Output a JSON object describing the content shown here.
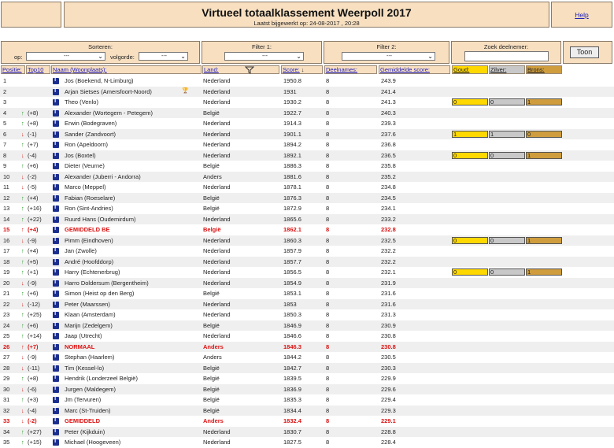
{
  "header": {
    "title": "Virtueel totaalklassement Weerpoll 2017",
    "updated": "Laatst bijgewerkt op: 24-08-2017 , 20:28",
    "help_label": "Help"
  },
  "filters": {
    "sorteren_label": "Sorteren:",
    "op_label": "op:",
    "op_value": "---",
    "volgorde_label": "volgorde:",
    "volgorde_value": "---",
    "filter1_label": "Filter 1:",
    "filter1_value": "---",
    "filter2_label": "Filter 2:",
    "filter2_value": "---",
    "zoek_label": "Zoek deelnemer:",
    "zoek_value": "",
    "toon_label": "Toon"
  },
  "columns": {
    "posities": "Positie:",
    "top10": "Top10",
    "naam": "Naam (Woonplaats):",
    "land": "Land:",
    "score": "Score:",
    "deelnames": "Deelnames:",
    "gemiddelde": "Gemiddelde score:",
    "goud": "Goud:",
    "zilver": "Zilver:",
    "brons": "Brons:"
  },
  "rows": [
    {
      "pos": "1",
      "change": "",
      "dir": "",
      "name": "Jos (Boekend, N-Limburg)",
      "land": "Nederland",
      "score": "1950.8",
      "deel": "8",
      "avg": "243.9"
    },
    {
      "pos": "2",
      "change": "",
      "dir": "",
      "name": "Arjan Sietses (Amersfoort-Noord)",
      "land": "Nederland",
      "score": "1931",
      "deel": "8",
      "avg": "241.4",
      "trophy": true
    },
    {
      "pos": "3",
      "change": "",
      "dir": "",
      "name": "Theo (Venlo)",
      "land": "Nederland",
      "score": "1930.2",
      "deel": "8",
      "avg": "241.3",
      "medals": [
        "0",
        "0",
        "1"
      ]
    },
    {
      "pos": "4",
      "change": "(+8)",
      "dir": "up",
      "name": "Alexander (Wortegem - Petegem)",
      "land": "België",
      "score": "1922.7",
      "deel": "8",
      "avg": "240.3"
    },
    {
      "pos": "5",
      "change": "(+8)",
      "dir": "up",
      "name": "Erwin (Bodegraven)",
      "land": "Nederland",
      "score": "1914.3",
      "deel": "8",
      "avg": "239.3"
    },
    {
      "pos": "6",
      "change": "(-1)",
      "dir": "down",
      "name": "Sander (Zandvoort)",
      "land": "Nederland",
      "score": "1901.1",
      "deel": "8",
      "avg": "237.6",
      "medals": [
        "1",
        "1",
        "0"
      ]
    },
    {
      "pos": "7",
      "change": "(+7)",
      "dir": "up",
      "name": "Ron (Apeldoorn)",
      "land": "Nederland",
      "score": "1894.2",
      "deel": "8",
      "avg": "236.8"
    },
    {
      "pos": "8",
      "change": "(-4)",
      "dir": "down",
      "name": "Jos (Boxtel)",
      "land": "Nederland",
      "score": "1892.1",
      "deel": "8",
      "avg": "236.5",
      "medals": [
        "0",
        "0",
        "1"
      ]
    },
    {
      "pos": "9",
      "change": "(+6)",
      "dir": "up",
      "name": "Dieter (Veurne)",
      "land": "België",
      "score": "1886.3",
      "deel": "8",
      "avg": "235.8"
    },
    {
      "pos": "10",
      "change": "(-2)",
      "dir": "down",
      "name": "Alexander (Juberri - Andorra)",
      "land": "Anders",
      "score": "1881.6",
      "deel": "8",
      "avg": "235.2"
    },
    {
      "pos": "11",
      "change": "(-5)",
      "dir": "down",
      "name": "Marco (Meppel)",
      "land": "Nederland",
      "score": "1878.1",
      "deel": "8",
      "avg": "234.8"
    },
    {
      "pos": "12",
      "change": "(+4)",
      "dir": "up",
      "name": "Fabian (Roeselare)",
      "land": "België",
      "score": "1876.3",
      "deel": "8",
      "avg": "234.5"
    },
    {
      "pos": "13",
      "change": "(+16)",
      "dir": "up",
      "name": "Ron (Sint-Andries)",
      "land": "België",
      "score": "1872.9",
      "deel": "8",
      "avg": "234.1"
    },
    {
      "pos": "14",
      "change": "(+22)",
      "dir": "up",
      "name": "Ruurd Hans (Oudemirdum)",
      "land": "Nederland",
      "score": "1865.6",
      "deel": "8",
      "avg": "233.2"
    },
    {
      "pos": "15",
      "change": "(+4)",
      "dir": "up",
      "name": "GEMIDDELD BE",
      "land": "België",
      "score": "1862.1",
      "deel": "8",
      "avg": "232.8",
      "red": true
    },
    {
      "pos": "16",
      "change": "(-9)",
      "dir": "down",
      "name": "Pimm (Eindhoven)",
      "land": "Nederland",
      "score": "1860.3",
      "deel": "8",
      "avg": "232.5",
      "medals": [
        "0",
        "0",
        "1"
      ]
    },
    {
      "pos": "17",
      "change": "(+4)",
      "dir": "up",
      "name": "Jan (Zwolle)",
      "land": "Nederland",
      "score": "1857.9",
      "deel": "8",
      "avg": "232.2"
    },
    {
      "pos": "18",
      "change": "(+5)",
      "dir": "up",
      "name": "André (Hoofddorp)",
      "land": "Nederland",
      "score": "1857.7",
      "deel": "8",
      "avg": "232.2"
    },
    {
      "pos": "19",
      "change": "(+1)",
      "dir": "up",
      "name": "Harry (Echtenerbrug)",
      "land": "Nederland",
      "score": "1856.5",
      "deel": "8",
      "avg": "232.1",
      "medals": [
        "0",
        "0",
        "1"
      ]
    },
    {
      "pos": "20",
      "change": "(-9)",
      "dir": "down",
      "name": "Harro Doldersum (Bergentheim)",
      "land": "Nederland",
      "score": "1854.9",
      "deel": "8",
      "avg": "231.9"
    },
    {
      "pos": "21",
      "change": "(+6)",
      "dir": "up",
      "name": "Simon (Heist op den Berg)",
      "land": "België",
      "score": "1853.1",
      "deel": "8",
      "avg": "231.6"
    },
    {
      "pos": "22",
      "change": "(-12)",
      "dir": "down",
      "name": "Peter (Maarssen)",
      "land": "Nederland",
      "score": "1853",
      "deel": "8",
      "avg": "231.6"
    },
    {
      "pos": "23",
      "change": "(+25)",
      "dir": "up",
      "name": "Klaan (Amsterdam)",
      "land": "Nederland",
      "score": "1850.3",
      "deel": "8",
      "avg": "231.3"
    },
    {
      "pos": "24",
      "change": "(+6)",
      "dir": "up",
      "name": "Marijn (Zedelgem)",
      "land": "België",
      "score": "1846.9",
      "deel": "8",
      "avg": "230.9"
    },
    {
      "pos": "25",
      "change": "(+14)",
      "dir": "up",
      "name": "Jaap (Utrecht)",
      "land": "Nederland",
      "score": "1846.6",
      "deel": "8",
      "avg": "230.8"
    },
    {
      "pos": "26",
      "change": "(+7)",
      "dir": "up",
      "name": "NORMAAL",
      "land": "Anders",
      "score": "1846.3",
      "deel": "8",
      "avg": "230.8",
      "red": true
    },
    {
      "pos": "27",
      "change": "(-9)",
      "dir": "down",
      "name": "Stephan (Haarlem)",
      "land": "Anders",
      "score": "1844.2",
      "deel": "8",
      "avg": "230.5"
    },
    {
      "pos": "28",
      "change": "(-11)",
      "dir": "down",
      "name": "Tim (Kessel-lo)",
      "land": "België",
      "score": "1842.7",
      "deel": "8",
      "avg": "230.3"
    },
    {
      "pos": "29",
      "change": "(+8)",
      "dir": "up",
      "name": "Hendrik (Londerzeel België)",
      "land": "België",
      "score": "1839.5",
      "deel": "8",
      "avg": "229.9"
    },
    {
      "pos": "30",
      "change": "(-6)",
      "dir": "down",
      "name": "Jurgen (Maldegem)",
      "land": "België",
      "score": "1836.9",
      "deel": "8",
      "avg": "229.6"
    },
    {
      "pos": "31",
      "change": "(+3)",
      "dir": "up",
      "name": "Jm (Tervuren)",
      "land": "België",
      "score": "1835.3",
      "deel": "8",
      "avg": "229.4"
    },
    {
      "pos": "32",
      "change": "(-4)",
      "dir": "down",
      "name": "Marc (St-Truiden)",
      "land": "België",
      "score": "1834.4",
      "deel": "8",
      "avg": "229.3"
    },
    {
      "pos": "33",
      "change": "(-2)",
      "dir": "down",
      "name": "GEMIDDELD",
      "land": "Anders",
      "score": "1832.4",
      "deel": "8",
      "avg": "229.1",
      "red": true
    },
    {
      "pos": "34",
      "change": "(+27)",
      "dir": "up",
      "name": "Peter (Kijkduin)",
      "land": "Nederland",
      "score": "1830.7",
      "deel": "8",
      "avg": "228.8"
    },
    {
      "pos": "35",
      "change": "(+15)",
      "dir": "up",
      "name": "Michael (Hoogeveen)",
      "land": "Nederland",
      "score": "1827.5",
      "deel": "8",
      "avg": "228.4"
    }
  ]
}
